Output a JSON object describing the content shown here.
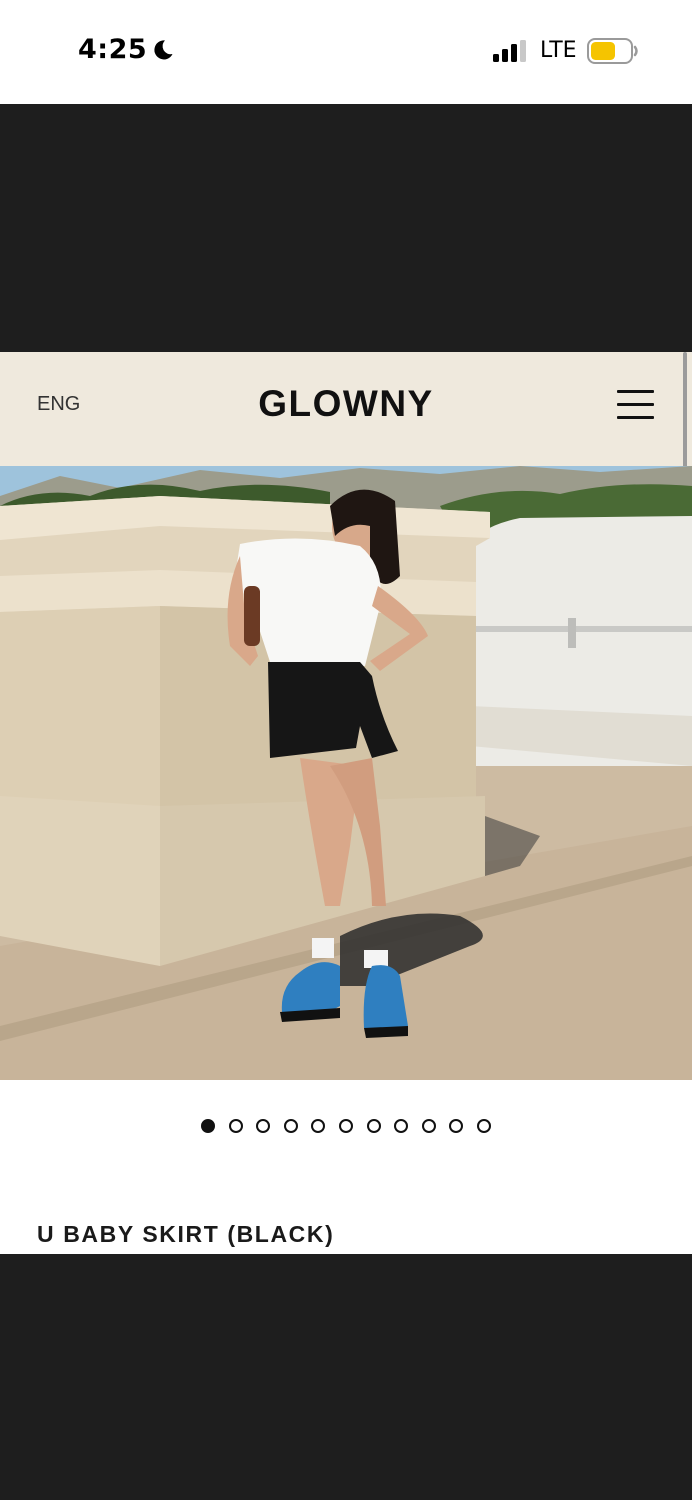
{
  "status_bar": {
    "time": "4:25",
    "network": "LTE",
    "icons": [
      "moon-icon",
      "signal-icon",
      "battery-icon"
    ],
    "battery_color": "#f5c400"
  },
  "header": {
    "language": "ENG",
    "brand": "GLOWNY",
    "menu_icon": "hamburger-menu-icon",
    "background": "#efe9dd"
  },
  "carousel": {
    "total": 11,
    "active_index": 0
  },
  "product": {
    "title": "U BABY SKIRT (BLACK)"
  },
  "colors": {
    "letterbox": "#1e1e1e",
    "text": "#111111"
  }
}
